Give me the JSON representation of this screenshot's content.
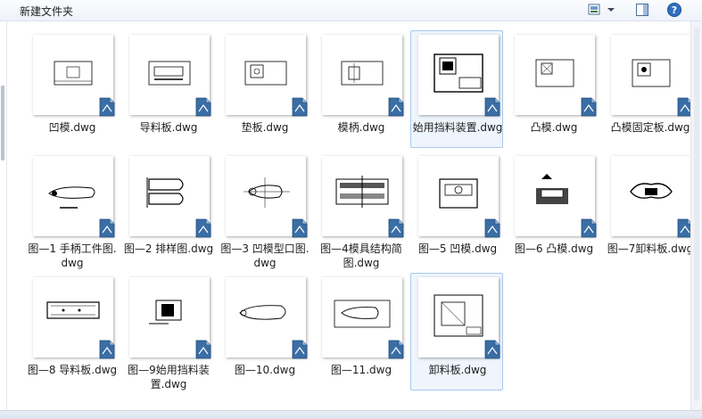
{
  "window": {
    "title": "新建文件夹"
  },
  "toolbar": {
    "view_icon": "view-thumbnails-icon",
    "dropdown_icon": "chevron-down-icon",
    "pane_icon": "preview-pane-icon",
    "help_icon": "help-icon"
  },
  "files": [
    {
      "name": "凹模.dwg"
    },
    {
      "name": "导料板.dwg"
    },
    {
      "name": "垫板.dwg"
    },
    {
      "name": "模柄.dwg"
    },
    {
      "name": "始用挡料装置.dwg",
      "selected": true
    },
    {
      "name": "凸模.dwg"
    },
    {
      "name": "凸模固定板.dwg"
    },
    {
      "name": "图—1 手柄工件图.dwg"
    },
    {
      "name": "图—2 排样图.dwg"
    },
    {
      "name": "图—3 凹模型口图.dwg"
    },
    {
      "name": "图—4模具结构简图.dwg"
    },
    {
      "name": "图—5 凹模.dwg"
    },
    {
      "name": "图—6 凸模.dwg"
    },
    {
      "name": "图—7卸料板.dwg"
    },
    {
      "name": "图—8 导料板.dwg"
    },
    {
      "name": "图—9始用挡料装置.dwg"
    },
    {
      "name": "图—10.dwg"
    },
    {
      "name": "图—11.dwg"
    },
    {
      "name": "卸料板.dwg",
      "selected": true
    }
  ],
  "colors": {
    "accent": "#3a6ea5",
    "selection_bg": "#eef5fd",
    "selection_border": "#a8c8ec"
  }
}
